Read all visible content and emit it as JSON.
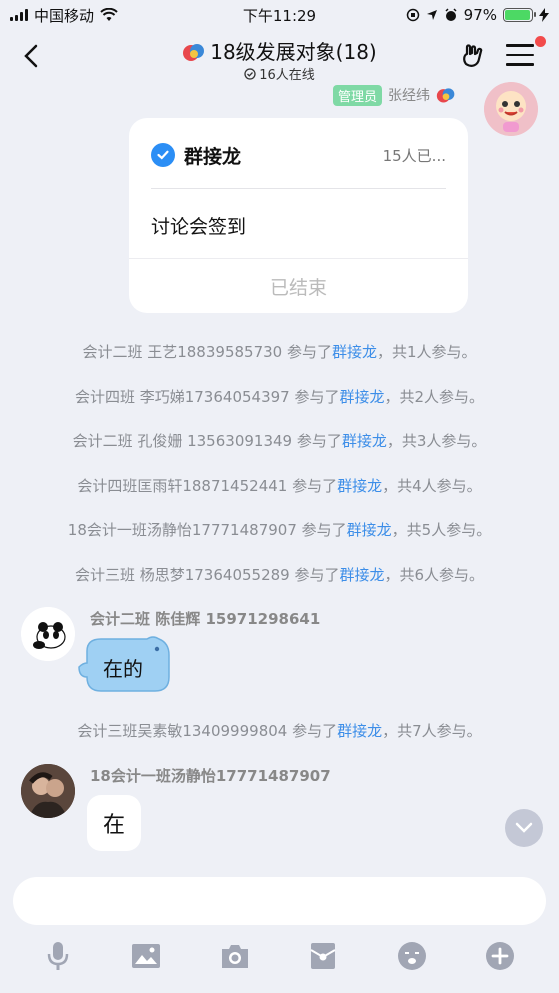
{
  "status_bar": {
    "carrier": "中国移动",
    "time": "下午11:29",
    "battery": "97%",
    "battery_level": 0.97
  },
  "header": {
    "back_icon": "chevron-left-icon",
    "title": "18级发展对象(18)",
    "subtitle": "16人在线",
    "has_notification_dot": true
  },
  "messages": {
    "top_sender": {
      "badge": "管理员",
      "name": "张经纬"
    },
    "card": {
      "title": "群接龙",
      "count": "15人已...",
      "content": "讨论会签到",
      "status": "已结束"
    },
    "system_lines": [
      {
        "prefix": "会计二班 王艺18839585730 参与了",
        "link": "群接龙",
        "suffix": "，共1人参与。"
      },
      {
        "prefix": "会计四班 李巧娣17364054397 参与了",
        "link": "群接龙",
        "suffix": "，共2人参与。"
      },
      {
        "prefix": "会计二班 孔俊姗 13563091349 参与了",
        "link": "群接龙",
        "suffix": "，共3人参与。"
      },
      {
        "prefix": "会计四班匡雨轩18871452441 参与了",
        "link": "群接龙",
        "suffix": "，共4人参与。"
      },
      {
        "prefix": "18会计一班汤静怡17771487907 参与了",
        "link": "群接龙",
        "suffix": "，共5人参与。"
      },
      {
        "prefix": "会计三班 杨思梦17364055289 参与了",
        "link": "群接龙",
        "suffix": "，共6人参与。"
      },
      {
        "prefix": "会计三班吴素敏13409999804 参与了",
        "link": "群接龙",
        "suffix": "，共7人参与。"
      }
    ],
    "msg1": {
      "name": "会计二班 陈佳辉 15971298641",
      "text": "在的"
    },
    "msg2": {
      "name": "18会计一班汤静怡17771487907",
      "text": "在"
    }
  },
  "input": {
    "placeholder": ""
  },
  "toolbar_icons": [
    "microphone-icon",
    "image-icon",
    "camera-icon",
    "red-packet-icon",
    "emoji-icon",
    "plus-icon"
  ],
  "colors": {
    "accent": "#3d8ee8",
    "admin_badge": "#7fd9a5",
    "notification": "#f24b4b"
  }
}
